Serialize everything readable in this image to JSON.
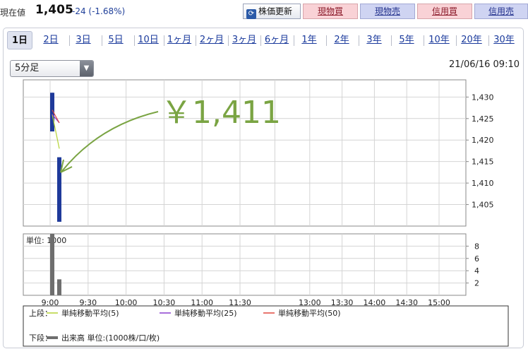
{
  "header": {
    "price_label": "現在値",
    "price_value": "1,405",
    "price_change": "-24 (-1.68%)",
    "refresh_label": "株価更新",
    "buttons": [
      "現物買",
      "現物売",
      "信用買",
      "信用売"
    ]
  },
  "tabs": [
    "1日",
    "2日",
    "3日",
    "5日",
    "10日",
    "1ヶ月",
    "2ヶ月",
    "3ヶ月",
    "6ヶ月",
    "1年",
    "2年",
    "3年",
    "5年",
    "10年",
    "20年",
    "30年"
  ],
  "interval_select": "5分足",
  "timestamp": "21/06/16 09:10",
  "annotation": "￥1,411",
  "colors": {
    "candle": "#1f3a9a",
    "volume": "#6e6e6e",
    "sma5": "#b5d335",
    "sma25": "#8a3fcf",
    "sma50": "#e0483f",
    "annotation": "#7aa443"
  },
  "chart_data": [
    {
      "type": "candlestick",
      "title": "",
      "ylim": [
        1400,
        1434
      ],
      "ytick_labels": [
        "1,430",
        "1,425",
        "1,420",
        "1,415",
        "1,410",
        "1,405"
      ],
      "yticks": [
        1430,
        1425,
        1420,
        1415,
        1410,
        1405
      ],
      "candles": [
        {
          "time": "9:00",
          "open": 1431,
          "high": 1431,
          "low": 1422,
          "close": 1422
        },
        {
          "time": "9:05",
          "open": 1416,
          "high": 1416,
          "low": 1401,
          "close": 1401
        }
      ],
      "series": [
        {
          "name": "単純移動平均(5)",
          "x": [
            "9:00",
            "9:05"
          ],
          "values": [
            1426,
            1418
          ]
        },
        {
          "name": "単純移動平均(25)",
          "x": [
            "9:00",
            "9:05"
          ],
          "values": [
            1426,
            1424
          ]
        },
        {
          "name": "単純移動平均(50)",
          "x": [
            "9:00",
            "9:05"
          ],
          "values": [
            1427,
            1424
          ]
        }
      ],
      "grid": true
    },
    {
      "type": "bar",
      "unit_label": "単位: 1000",
      "ylim": [
        0,
        10
      ],
      "yticks": [
        2,
        4,
        6,
        8
      ],
      "x": [
        "9:00",
        "9:05"
      ],
      "values": [
        10,
        2.6
      ],
      "xtick_labels": [
        "9:00",
        "9:30",
        "10:00",
        "10:30",
        "11:00",
        "11:30",
        "13:00",
        "13:30",
        "14:00",
        "14:30",
        "15:00"
      ],
      "grid": true
    }
  ],
  "legend": {
    "upper_label": "上段：",
    "lower_label": "下段：",
    "items": [
      "単純移動平均(5)",
      "単純移動平均(25)",
      "単純移動平均(50)"
    ],
    "volume_item": "出来高 単位:(1000株/口/枚)"
  }
}
